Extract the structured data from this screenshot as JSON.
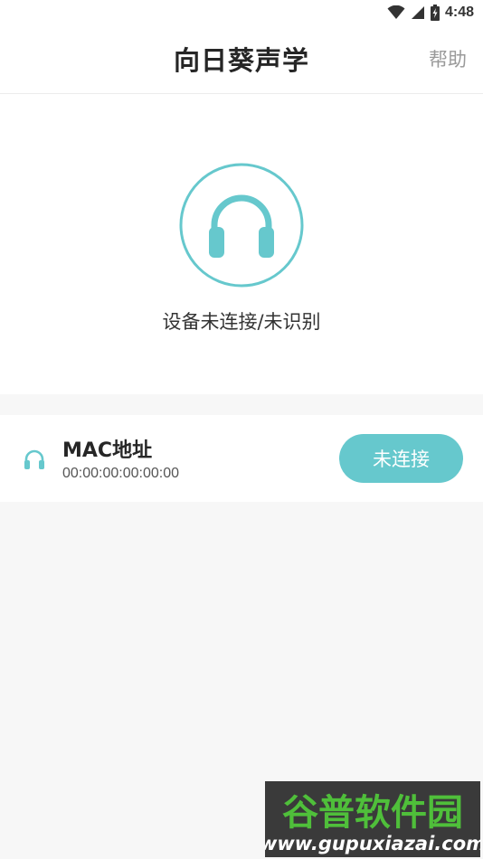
{
  "status_bar": {
    "time": "4:48",
    "icons": [
      "wifi-icon",
      "cell-signal-icon",
      "battery-charging-icon"
    ]
  },
  "header": {
    "title": "向日葵声学",
    "help_label": "帮助"
  },
  "hero": {
    "icon": "headphones-icon",
    "status_text": "设备未连接/未识别"
  },
  "device_card": {
    "icon": "headphones-icon",
    "mac_label": "MAC地址",
    "mac_value": "00:00:00:00:00:00",
    "button_label": "未连接"
  },
  "watermark": {
    "brand": "谷普软件园",
    "url": "www.gupuxiazai.com"
  },
  "colors": {
    "accent": "#66c8cd",
    "title_text": "#262626",
    "help_text": "#9a9a9a",
    "background": "#f7f7f7",
    "card": "#ffffff"
  }
}
